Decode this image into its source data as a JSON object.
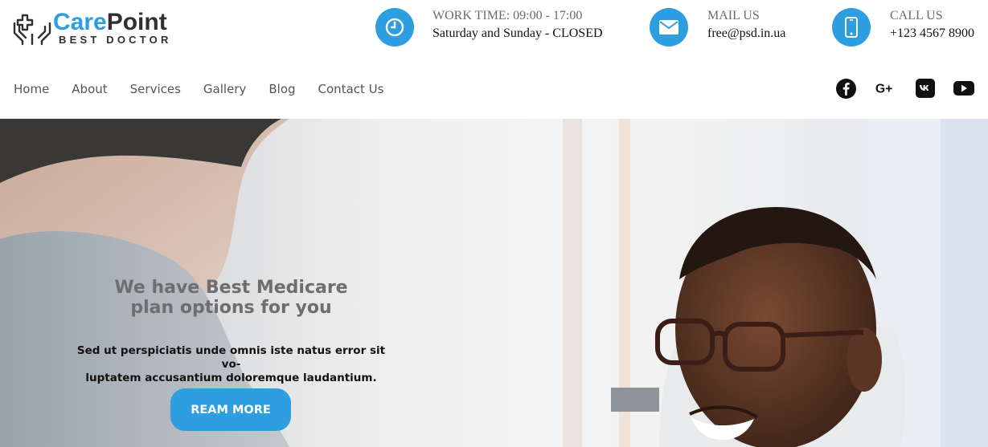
{
  "brand": {
    "name_part1": "Care",
    "name_part2": "Point",
    "tagline": "BEST DOCTOR",
    "accent_color": "#2e9ee0"
  },
  "contact": {
    "work": {
      "icon": "clock-icon",
      "label": "WORK TIME: 09:00 - 17:00",
      "value": "Saturday and Sunday - CLOSED"
    },
    "mail": {
      "icon": "envelope-icon",
      "label": "MAIL US",
      "value": "free@psd.in.ua"
    },
    "call": {
      "icon": "phone-icon",
      "label": "CALL US",
      "value": "+123 4567 8900"
    }
  },
  "nav": {
    "items": [
      "Home",
      "About",
      "Services",
      "Gallery",
      "Blog",
      "Contact Us"
    ]
  },
  "social": [
    "facebook-icon",
    "google-plus-icon",
    "vk-icon",
    "youtube-icon"
  ],
  "hero": {
    "title_line1": "We have Best Medicare",
    "title_line2": "plan options for you",
    "text_line1": "Sed ut perspiciatis unde omnis iste natus error sit vo-",
    "text_line2": "luptatem accusantium doloremque laudantium.",
    "button_label": "REAM MORE",
    "button_color": "#2d9ee0"
  },
  "google_plus_text": "G+"
}
